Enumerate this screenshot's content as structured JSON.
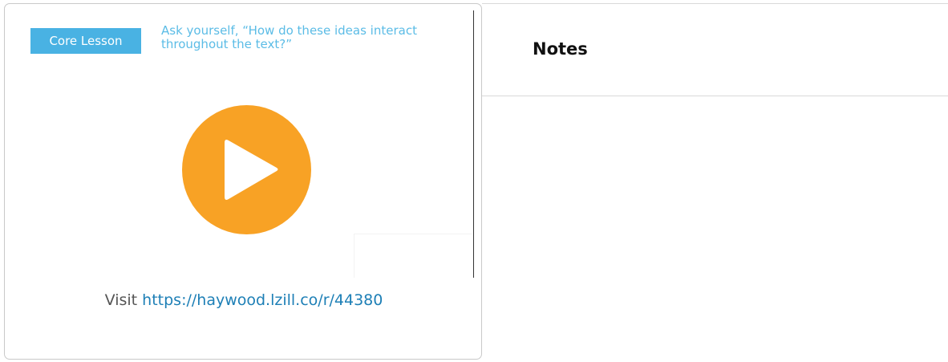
{
  "lesson": {
    "badge_label": "Core Lesson",
    "prompt_text": "Ask yourself, “How do these ideas interact throughout the text?”",
    "visit_prefix": "Visit ",
    "visit_url": "https://haywood.lzill.co/r/44380"
  },
  "notes": {
    "title": "Notes"
  },
  "colors": {
    "badge": "#49b2e3",
    "prompt": "#5bbce6",
    "play_button": "#f8a225",
    "link": "#1d7fb6"
  },
  "icons": {
    "play": "play-icon"
  }
}
